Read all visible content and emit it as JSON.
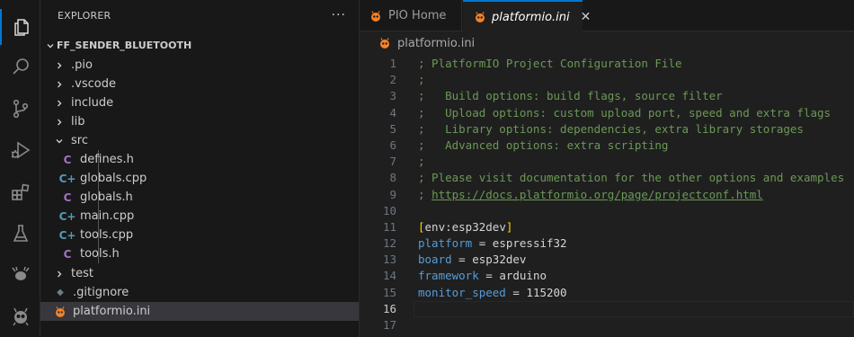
{
  "colors": {
    "accent": "#0078d4",
    "comment": "#6a9955",
    "keyword": "#569cd6",
    "bracket": "#ffd700",
    "platformio_orange": "#f5822a"
  },
  "activity_bar": {
    "items": [
      {
        "name": "explorer-icon",
        "active": true
      },
      {
        "name": "search-icon"
      },
      {
        "name": "source-control-icon"
      },
      {
        "name": "run-debug-icon"
      },
      {
        "name": "extensions-icon"
      },
      {
        "name": "testing-icon"
      },
      {
        "name": "platformio-ant-icon"
      },
      {
        "name": "platformio-alien-icon"
      }
    ]
  },
  "sidebar": {
    "title": "EXPLORER",
    "more_label": "···",
    "folder": "FF_SENDER_BLUETOOTH",
    "tree": [
      {
        "label": ".pio",
        "kind": "folder",
        "chevron": "›"
      },
      {
        "label": ".vscode",
        "kind": "folder",
        "chevron": "›"
      },
      {
        "label": "include",
        "kind": "folder",
        "chevron": "›"
      },
      {
        "label": "lib",
        "kind": "folder",
        "chevron": "›"
      },
      {
        "label": "src",
        "kind": "folder-open",
        "chevron": "⌄"
      },
      {
        "label": "defines.h",
        "kind": "h",
        "icon": "C"
      },
      {
        "label": "globals.cpp",
        "kind": "cpp",
        "icon": "C+"
      },
      {
        "label": "globals.h",
        "kind": "h",
        "icon": "C"
      },
      {
        "label": "main.cpp",
        "kind": "cpp",
        "icon": "C+"
      },
      {
        "label": "tools.cpp",
        "kind": "cpp",
        "icon": "C+"
      },
      {
        "label": "tools.h",
        "kind": "h",
        "icon": "C"
      },
      {
        "label": "test",
        "kind": "folder",
        "chevron": "›"
      },
      {
        "label": ".gitignore",
        "kind": "gitignore",
        "icon": "◆"
      },
      {
        "label": "platformio.ini",
        "kind": "ini",
        "selected": true
      }
    ]
  },
  "editor": {
    "tabs": [
      {
        "label": "PIO Home"
      },
      {
        "label": "platformio.ini",
        "active": true,
        "close": "✕"
      }
    ],
    "breadcrumb": "platformio.ini",
    "current_line": 16,
    "lines": [
      {
        "n": "1",
        "text": "; PlatformIO Project Configuration File"
      },
      {
        "n": "2",
        "text": ";"
      },
      {
        "n": "3",
        "text": ";   Build options: build flags, source filter"
      },
      {
        "n": "4",
        "text": ";   Upload options: custom upload port, speed and extra flags"
      },
      {
        "n": "5",
        "text": ";   Library options: dependencies, extra library storages"
      },
      {
        "n": "6",
        "text": ";   Advanced options: extra scripting"
      },
      {
        "n": "7",
        "text": ";"
      },
      {
        "n": "8",
        "text": "; Please visit documentation for the other options and examples"
      },
      {
        "n": "9",
        "prefix": "; ",
        "link": "https://docs.platformio.org/page/projectconf.html"
      },
      {
        "n": "10",
        "text": ""
      },
      {
        "n": "11",
        "bracket_open": "[",
        "section": "env:esp32dev",
        "bracket_close": "]"
      },
      {
        "n": "12",
        "key": "platform",
        "eq": " = ",
        "value": "espressif32"
      },
      {
        "n": "13",
        "key": "board",
        "eq": " = ",
        "value": "esp32dev"
      },
      {
        "n": "14",
        "key": "framework",
        "eq": " = ",
        "value": "arduino"
      },
      {
        "n": "15",
        "key": "monitor_speed",
        "eq": " = ",
        "value": "115200"
      },
      {
        "n": "16",
        "text": ""
      },
      {
        "n": "17",
        "text": ""
      }
    ]
  }
}
